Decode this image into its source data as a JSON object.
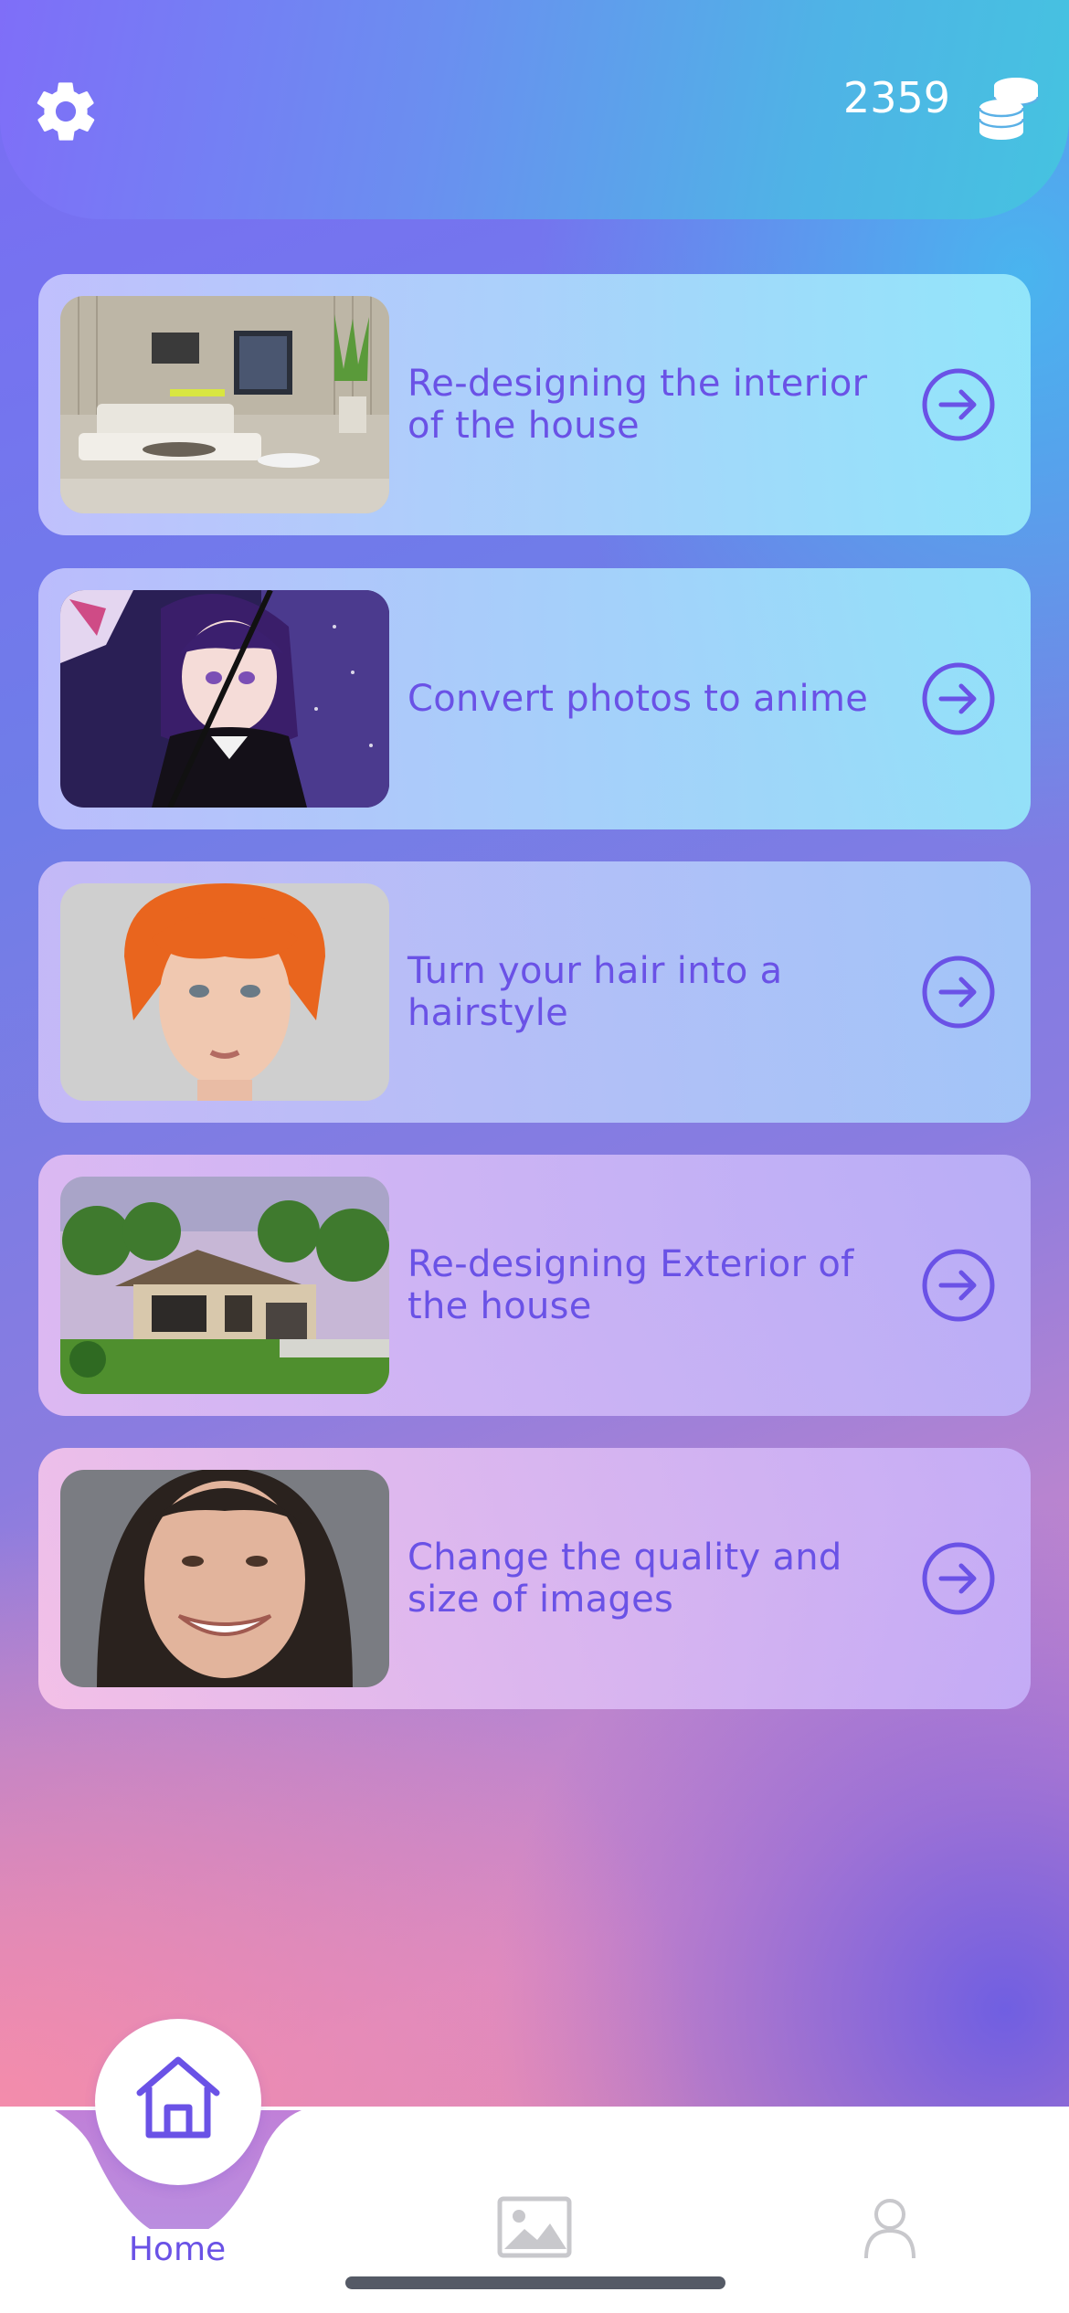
{
  "header": {
    "settings_icon": "gear-icon",
    "coin_count": "2359",
    "coin_icon": "coins-stack-icon"
  },
  "features": [
    {
      "label": "Re-designing the interior of the house",
      "image": "living-room-interior",
      "action_icon": "arrow-right-circle-icon"
    },
    {
      "label": "Convert photos to anime",
      "image": "anime-character",
      "action_icon": "arrow-right-circle-icon"
    },
    {
      "label": "Turn your hair into a hairstyle",
      "image": "woman-orange-hair",
      "action_icon": "arrow-right-circle-icon"
    },
    {
      "label": "Re-designing Exterior of the house",
      "image": "house-exterior",
      "action_icon": "arrow-right-circle-icon"
    },
    {
      "label": "Change the quality and size of images",
      "image": "smiling-woman-portrait",
      "action_icon": "arrow-right-circle-icon"
    }
  ],
  "tabbar": {
    "home_label": "Home",
    "tabs": [
      "home-icon",
      "gallery-icon",
      "profile-icon"
    ]
  },
  "colors": {
    "accent": "#6a52e6",
    "header_start": "#7f6ef8",
    "header_end": "#45c3e0"
  }
}
